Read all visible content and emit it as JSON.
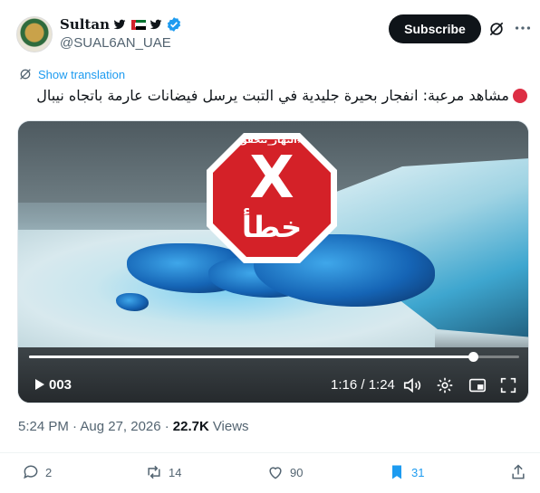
{
  "account": {
    "display_name": "Sultan",
    "handle": "@SUAL6AN_UAE",
    "subscribe_label": "Subscribe"
  },
  "post": {
    "show_translation": "Show translation",
    "text": "مشاهد مرعبة: انفجار بحيرة جليدية في التبت يرسل فيضانات عارمة باتجاه نيبال",
    "timestamp": "5:24 PM · Aug 27, 2026 · ",
    "views_count": "22.7K",
    "views_label": " Views"
  },
  "media": {
    "stamp_tag": "#النهار_تتحقق",
    "stamp_x": "X",
    "stamp_word": "خطأ",
    "badge_text": "003",
    "time_display": "1:16 / 1:24",
    "progress_fraction": 0.905
  },
  "actions": {
    "replies": "2",
    "reposts": "14",
    "likes": "90",
    "bookmarks": "31"
  },
  "colors": {
    "accent": "#1d9bf0",
    "stamp_red": "#d42128"
  }
}
